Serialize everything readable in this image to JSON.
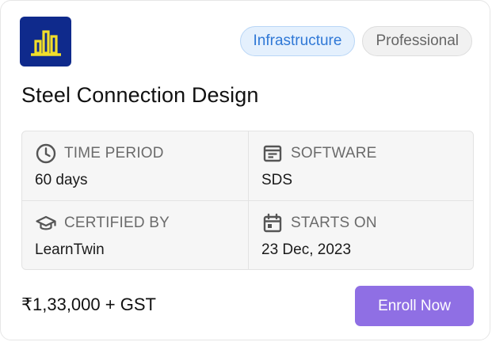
{
  "course": {
    "logo_icon": "building-chart-icon",
    "title": "Steel Connection Design",
    "tags": [
      "Infrastructure",
      "Professional"
    ]
  },
  "details": {
    "time_period": {
      "icon": "clock-icon",
      "label": "TIME PERIOD",
      "value": "60 days"
    },
    "software": {
      "icon": "software-window-icon",
      "label": "SOFTWARE",
      "value": "SDS"
    },
    "certified_by": {
      "icon": "graduation-cap-icon",
      "label": "CERTIFIED BY",
      "value": "LearnTwin"
    },
    "starts_on": {
      "icon": "calendar-icon",
      "label": "STARTS ON",
      "value": "23 Dec, 2023"
    }
  },
  "footer": {
    "price": "₹1,33,000 + GST",
    "enroll_label": "Enroll Now"
  },
  "colors": {
    "logo_bg": "#0f2a8c",
    "logo_fg": "#f2de2a",
    "accent": "#8f6fe4",
    "tag_infra": "#2f78d6"
  }
}
